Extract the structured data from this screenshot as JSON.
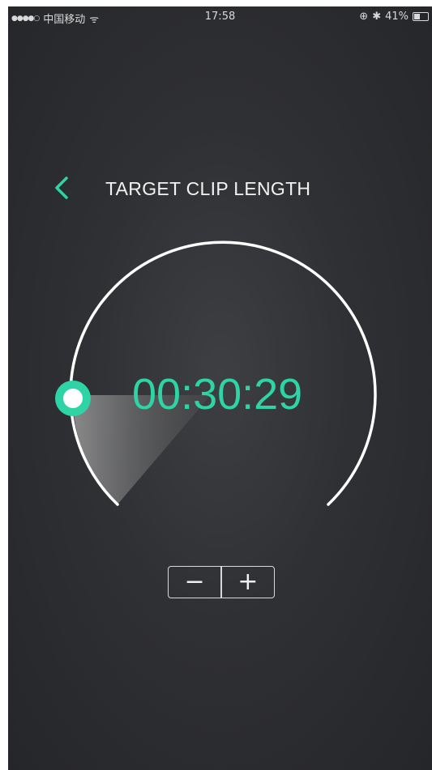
{
  "status_bar": {
    "signal": "●●●●○",
    "carrier": "中国移动",
    "wifi": "ᯤ",
    "time": "17:58",
    "lock": "⊕",
    "bluetooth": "✱",
    "battery_percent": "41%"
  },
  "header": {
    "back_icon": "chevron-left-icon",
    "title": "TARGET CLIP LENGTH"
  },
  "timer": {
    "value": "00:30:29",
    "accent_color": "#2fd4a6"
  },
  "stepper": {
    "decrement_label": "−",
    "increment_label": "+"
  }
}
